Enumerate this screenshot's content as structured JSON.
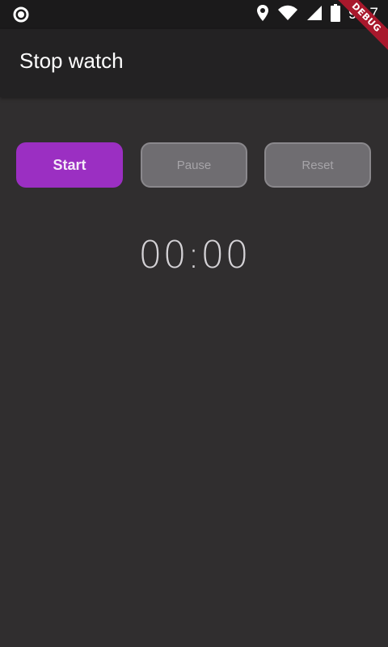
{
  "status_bar": {
    "time": "9:17",
    "icons": [
      "circle-notification-icon",
      "location-icon",
      "wifi-icon",
      "cell-signal-icon",
      "battery-icon"
    ]
  },
  "debug_banner": "DEBUG",
  "app_bar": {
    "title": "Stop watch"
  },
  "buttons": {
    "start": "Start",
    "middle": "Pause",
    "right": "Reset"
  },
  "timer": {
    "display": "00:00"
  },
  "colors": {
    "background": "#302e2f",
    "app_bar": "#232223",
    "start_button": "#9b2fc2",
    "disabled_button": "#6f6d71",
    "debug_banner": "#a8182c"
  }
}
